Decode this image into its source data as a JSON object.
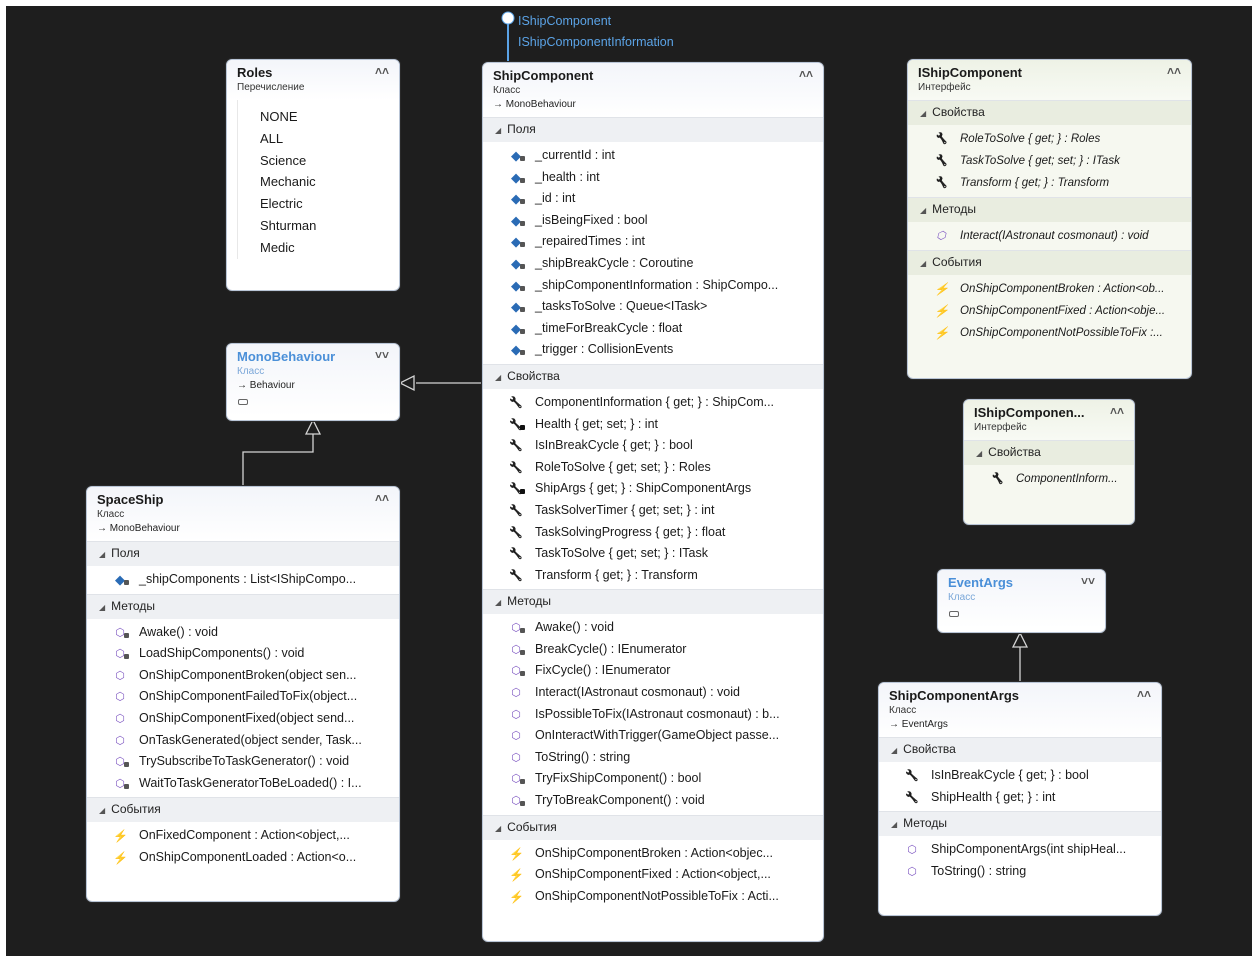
{
  "lollipop": {
    "interfaces": [
      "IShipComponent",
      "IShipComponentInformation"
    ]
  },
  "roles": {
    "title": "Roles",
    "kind": "Перечисление",
    "values": [
      "NONE",
      "ALL",
      "Science",
      "Mechanic",
      "Electric",
      "Shturman",
      "Medic"
    ]
  },
  "monobehaviour": {
    "title": "MonoBehaviour",
    "kind": "Класс",
    "base": "Behaviour"
  },
  "spaceship": {
    "title": "SpaceShip",
    "kind": "Класс",
    "base": "MonoBehaviour",
    "sections": [
      {
        "label": "Поля",
        "items": [
          {
            "text": "_shipComponents : List<IShipCompo...",
            "icon": "field",
            "private": true
          }
        ]
      },
      {
        "label": "Методы",
        "items": [
          {
            "text": "Awake() : void",
            "icon": "method",
            "private": true
          },
          {
            "text": "LoadShipComponents() : void",
            "icon": "method",
            "private": true
          },
          {
            "text": "OnShipComponentBroken(object sen...",
            "icon": "method",
            "private": false
          },
          {
            "text": "OnShipComponentFailedToFix(object...",
            "icon": "method",
            "private": false
          },
          {
            "text": "OnShipComponentFixed(object send...",
            "icon": "method",
            "private": false
          },
          {
            "text": "OnTaskGenerated(object sender, Task...",
            "icon": "method",
            "private": false
          },
          {
            "text": "TrySubscribeToTaskGenerator() : void",
            "icon": "method",
            "private": true
          },
          {
            "text": "WaitToTaskGeneratorToBeLoaded() : I...",
            "icon": "method",
            "private": true
          }
        ]
      },
      {
        "label": "События",
        "items": [
          {
            "text": "OnFixedComponent : Action<object,...",
            "icon": "event",
            "private": false
          },
          {
            "text": "OnShipComponentLoaded : Action<o...",
            "icon": "event",
            "private": false
          }
        ]
      }
    ]
  },
  "shipcomponent": {
    "title": "ShipComponent",
    "kind": "Класс",
    "base": "MonoBehaviour",
    "sections": [
      {
        "label": "Поля",
        "items": [
          {
            "text": "_currentId : int",
            "icon": "field",
            "private": true
          },
          {
            "text": "_health : int",
            "icon": "field",
            "private": true
          },
          {
            "text": "_id : int",
            "icon": "field",
            "private": true
          },
          {
            "text": "_isBeingFixed : bool",
            "icon": "field",
            "private": true
          },
          {
            "text": "_repairedTimes : int",
            "icon": "field",
            "private": true
          },
          {
            "text": "_shipBreakCycle : Coroutine",
            "icon": "field",
            "private": true
          },
          {
            "text": "_shipComponentInformation : ShipCompo...",
            "icon": "field",
            "private": true
          },
          {
            "text": "_tasksToSolve : Queue<ITask>",
            "icon": "field",
            "private": true
          },
          {
            "text": "_timeForBreakCycle : float",
            "icon": "field",
            "private": true
          },
          {
            "text": "_trigger : CollisionEvents",
            "icon": "field",
            "private": true
          }
        ]
      },
      {
        "label": "Свойства",
        "items": [
          {
            "text": "ComponentInformation { get; } : ShipCom...",
            "icon": "prop",
            "private": false
          },
          {
            "text": "Health { get; set; } : int",
            "icon": "prop",
            "private": true
          },
          {
            "text": "IsInBreakCycle { get; } : bool",
            "icon": "prop",
            "private": false
          },
          {
            "text": "RoleToSolve { get; set; } : Roles",
            "icon": "prop",
            "private": false
          },
          {
            "text": "ShipArgs { get; } : ShipComponentArgs",
            "icon": "prop",
            "private": true
          },
          {
            "text": "TaskSolverTimer { get; set; } : int",
            "icon": "prop",
            "private": false
          },
          {
            "text": "TaskSolvingProgress { get; } : float",
            "icon": "prop",
            "private": false
          },
          {
            "text": "TaskToSolve { get; set; } : ITask",
            "icon": "prop",
            "private": false
          },
          {
            "text": "Transform { get; } : Transform",
            "icon": "prop",
            "private": false
          }
        ]
      },
      {
        "label": "Методы",
        "items": [
          {
            "text": "Awake() : void",
            "icon": "method",
            "private": true
          },
          {
            "text": "BreakCycle() : IEnumerator",
            "icon": "method",
            "private": true
          },
          {
            "text": "FixCycle() : IEnumerator",
            "icon": "method",
            "private": true
          },
          {
            "text": "Interact(IAstronaut cosmonaut) : void",
            "icon": "method",
            "private": false
          },
          {
            "text": "IsPossibleToFix(IAstronaut cosmonaut) : b...",
            "icon": "method",
            "private": false
          },
          {
            "text": "OnInteractWithTrigger(GameObject passe...",
            "icon": "method",
            "private": false
          },
          {
            "text": "ToString() : string",
            "icon": "method",
            "private": false
          },
          {
            "text": "TryFixShipComponent() : bool",
            "icon": "method",
            "private": true
          },
          {
            "text": "TryToBreakComponent() : void",
            "icon": "method",
            "private": true
          }
        ]
      },
      {
        "label": "События",
        "items": [
          {
            "text": "OnShipComponentBroken : Action<objec...",
            "icon": "event",
            "private": false
          },
          {
            "text": "OnShipComponentFixed : Action<object,...",
            "icon": "event",
            "private": false
          },
          {
            "text": "OnShipComponentNotPossibleToFix : Acti...",
            "icon": "event",
            "private": false
          }
        ]
      }
    ]
  },
  "ishipcomponent": {
    "title": "IShipComponent",
    "kind": "Интерфейс",
    "sections": [
      {
        "label": "Свойства",
        "items": [
          {
            "text": "RoleToSolve { get; } : Roles",
            "icon": "prop"
          },
          {
            "text": "TaskToSolve { get; set; } : ITask",
            "icon": "prop"
          },
          {
            "text": "Transform { get; } : Transform",
            "icon": "prop"
          }
        ]
      },
      {
        "label": "Методы",
        "items": [
          {
            "text": "Interact(IAstronaut cosmonaut) : void",
            "icon": "method"
          }
        ]
      },
      {
        "label": "События",
        "items": [
          {
            "text": "OnShipComponentBroken : Action<ob...",
            "icon": "event"
          },
          {
            "text": "OnShipComponentFixed : Action<obje...",
            "icon": "event"
          },
          {
            "text": "OnShipComponentNotPossibleToFix :...",
            "icon": "event"
          }
        ]
      }
    ]
  },
  "ishipcomponentinfo": {
    "title": "IShipComponen...",
    "kind": "Интерфейс",
    "sections": [
      {
        "label": "Свойства",
        "items": [
          {
            "text": "ComponentInform...",
            "icon": "prop"
          }
        ]
      }
    ]
  },
  "eventargs": {
    "title": "EventArgs",
    "kind": "Класс"
  },
  "shipcomponentargs": {
    "title": "ShipComponentArgs",
    "kind": "Класс",
    "base": "EventArgs",
    "sections": [
      {
        "label": "Свойства",
        "items": [
          {
            "text": "IsInBreakCycle { get; } : bool",
            "icon": "prop"
          },
          {
            "text": "ShipHealth { get; } : int",
            "icon": "prop"
          }
        ]
      },
      {
        "label": "Методы",
        "items": [
          {
            "text": "ShipComponentArgs(int shipHeal...",
            "icon": "method"
          },
          {
            "text": "ToString() : string",
            "icon": "method"
          }
        ]
      }
    ]
  },
  "colors": {
    "canvas": "#1e1e1e",
    "external_title": "#4a8fd8",
    "field_icon": "#2a6bb5",
    "method_icon": "#7e57c2",
    "event_icon": "#e08a16",
    "connector": "#d4d4d4",
    "lollipop": "#5ba3e6"
  },
  "icons": {
    "field": "field-icon",
    "prop": "wrench-icon",
    "method": "method-cube-icon",
    "event": "lightning-icon",
    "collapse": "double-chevron-up-icon",
    "expand": "double-chevron-down-icon"
  }
}
